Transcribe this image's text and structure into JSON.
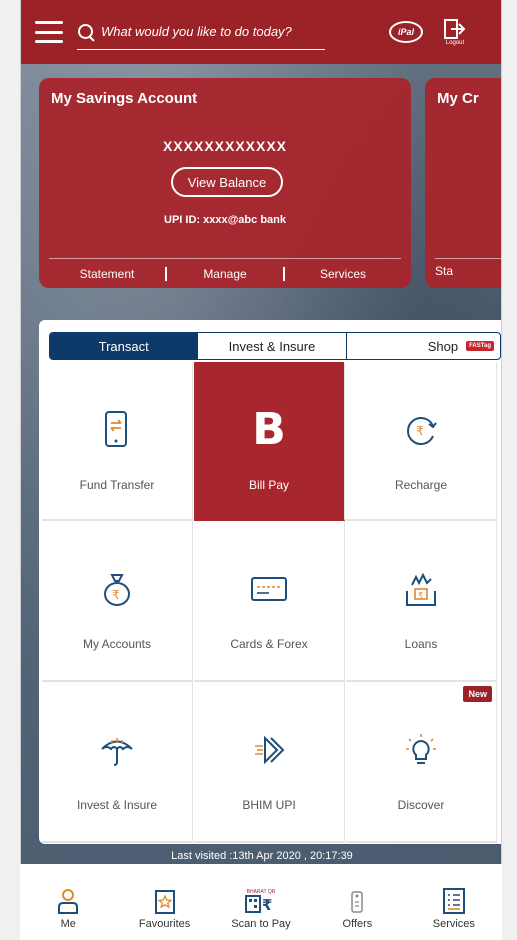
{
  "header": {
    "search_placeholder": "What would you like to do today?",
    "ipal_label": "iPal",
    "logout_label": "Logout"
  },
  "account": {
    "title": "My Savings Account",
    "number": "XXXXXXXXXXXX",
    "view_balance": "View Balance",
    "upi_id": "UPI ID:  xxxx@abc bank",
    "links": [
      "Statement",
      "Manage",
      "Services"
    ]
  },
  "account_peek": {
    "title": "My Cr",
    "link": "Sta"
  },
  "tabs": [
    {
      "label": "Transact",
      "active": true
    },
    {
      "label": "Invest & Insure",
      "active": false
    },
    {
      "label": "Shop",
      "active": false,
      "badge": "FASTag"
    }
  ],
  "tiles": [
    {
      "label": "Fund Transfer",
      "icon": "phone-transfer-icon"
    },
    {
      "label": "Bill Pay",
      "icon": "bill-pay-b-icon",
      "highlighted": true,
      "glyph": "B"
    },
    {
      "label": "Recharge",
      "icon": "recharge-icon"
    },
    {
      "label": "My Accounts",
      "icon": "money-bag-icon"
    },
    {
      "label": "Cards & Forex",
      "icon": "card-icon"
    },
    {
      "label": "Loans",
      "icon": "loans-icon"
    },
    {
      "label": "Invest & Insure",
      "icon": "umbrella-icon"
    },
    {
      "label": "BHIM UPI",
      "icon": "bhim-upi-icon"
    },
    {
      "label": "Discover",
      "icon": "lightbulb-icon",
      "badge": "New"
    }
  ],
  "last_visited": "Last visited :13th Apr 2020 , 20:17:39",
  "bottom_nav": [
    {
      "label": "Me",
      "icon": "person-icon"
    },
    {
      "label": "Favourites",
      "icon": "star-bookmark-icon"
    },
    {
      "label": "Scan to Pay",
      "icon": "scan-pay-icon",
      "mini_text": "BHARAT QR"
    },
    {
      "label": "Offers",
      "icon": "offers-tag-icon"
    },
    {
      "label": "Services",
      "icon": "services-list-icon"
    }
  ],
  "colors": {
    "brand_red": "#9b2226",
    "tab_navy": "#0d3a6a",
    "icon_blue": "#1f4e7a",
    "icon_orange": "#e0892c"
  }
}
